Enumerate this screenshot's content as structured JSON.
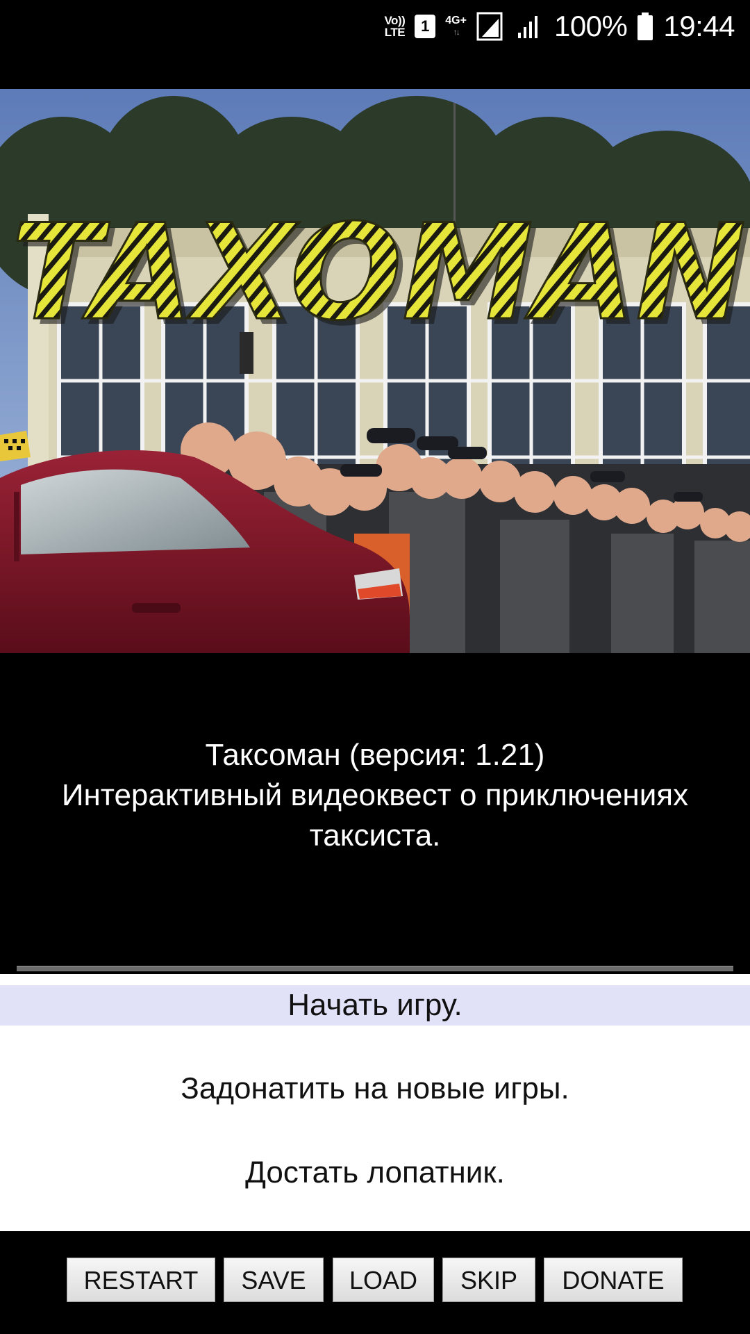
{
  "status_bar": {
    "volte_top": "Vo))",
    "volte_bottom": "LTE",
    "sim": "1",
    "network": "4G+",
    "battery": "100%",
    "time": "19:44"
  },
  "hero": {
    "logo_text": "TAXOMAN"
  },
  "description": {
    "line1": "Таксоман (версия: 1.21)",
    "line2": "Интерактивный видеоквест о приключениях",
    "line3": "таксиста."
  },
  "menu": {
    "items": [
      {
        "label": "Начать игру."
      },
      {
        "label": "Задонатить на новые игры."
      },
      {
        "label": "Достать лопатник."
      }
    ]
  },
  "toolbar": {
    "restart": "RESTART",
    "save": "SAVE",
    "load": "LOAD",
    "skip": "SKIP",
    "donate": "DONATE"
  },
  "colors": {
    "menu_selected": "#e1e1f8",
    "logo_yellow": "#e6e63a",
    "car_red": "#7a1526"
  }
}
